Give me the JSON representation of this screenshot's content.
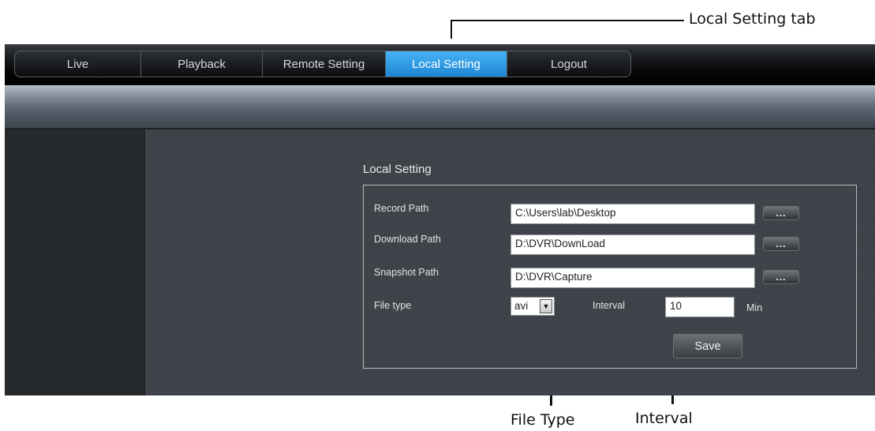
{
  "callouts": {
    "local_setting_tab": "Local Setting tab",
    "file_type": "File Type",
    "interval": "Interval"
  },
  "nav": {
    "tabs": [
      "Live",
      "Playback",
      "Remote Setting",
      "Local Setting",
      "Logout"
    ],
    "active_tab": "Local Setting"
  },
  "section": {
    "title": "Local Setting"
  },
  "form": {
    "record_path": {
      "label": "Record Path",
      "value": "C:\\Users\\lab\\Desktop",
      "button": "..."
    },
    "download_path": {
      "label": "Download Path",
      "value": "D:\\DVR\\DownLoad",
      "button": "..."
    },
    "snapshot_path": {
      "label": "Snapshot Path",
      "value": "D:\\DVR\\Capture",
      "button": "..."
    },
    "file_type": {
      "label": "File type",
      "value": "avi"
    },
    "interval": {
      "label": "Interval",
      "value": "10",
      "unit": "Min"
    },
    "save_label": "Save"
  },
  "colors": {
    "active_tab": "#2a96e0",
    "panel": "#3d4248",
    "page_background": "#ffffff"
  }
}
